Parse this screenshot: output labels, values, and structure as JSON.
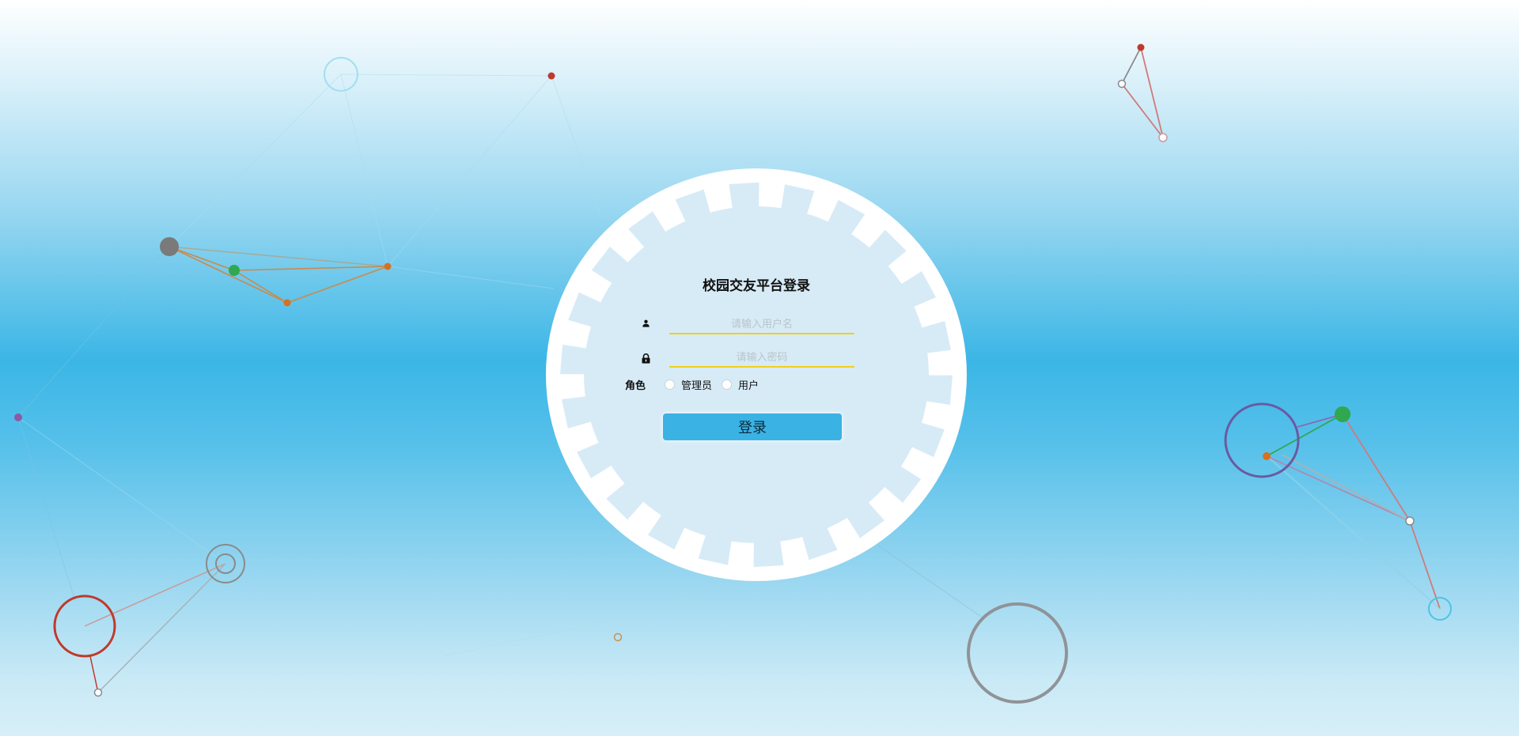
{
  "login": {
    "title": "校园交友平台登录",
    "username_placeholder": "请输入用户名",
    "password_placeholder": "请输入密码",
    "role_label": "角色",
    "role_options": [
      "管理员",
      "用户"
    ],
    "submit_label": "登录"
  },
  "colors": {
    "accent_button": "#3bb2e4",
    "input_underline": "#f2cf1c",
    "disc_inner": "#d7ebf6"
  },
  "icons": [
    "user-icon",
    "lock-icon"
  ]
}
